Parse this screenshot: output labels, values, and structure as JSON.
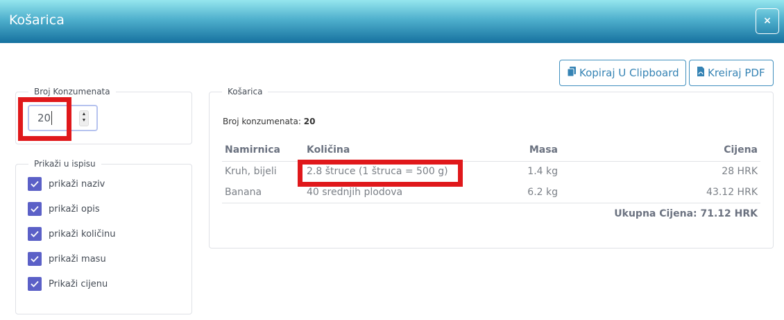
{
  "modal": {
    "title": "Košarica",
    "close_label": "×"
  },
  "toolbar": {
    "copy_label": "Kopiraj U Clipboard",
    "pdf_label": "Kreiraj PDF",
    "copy_icon": "copy-icon",
    "pdf_icon": "pdf-file-icon"
  },
  "consumers": {
    "legend": "Broj Konzumenata",
    "value": "20"
  },
  "print_options": {
    "legend": "Prikaži u ispisu",
    "items": [
      {
        "label": "prikaži naziv",
        "checked": true
      },
      {
        "label": "prikaži opis",
        "checked": true
      },
      {
        "label": "prikaži količinu",
        "checked": true
      },
      {
        "label": "prikaži masu",
        "checked": true
      },
      {
        "label": "Prikaži cijenu",
        "checked": true
      }
    ]
  },
  "cart": {
    "legend": "Košarica",
    "consumer_info_label": "Broj konzumenata:",
    "consumer_info_value": "20",
    "columns": [
      "Namirnica",
      "Količina",
      "Masa",
      "Cijena"
    ],
    "rows": [
      {
        "item": "Kruh, bijeli",
        "quantity": "2.8 štruce (1 štruca = 500 g)",
        "mass": "1.4 kg",
        "price": "28 HRK"
      },
      {
        "item": "Banana",
        "quantity": "40 srednjih plodova",
        "mass": "6.2 kg",
        "price": "43.12 HRK"
      }
    ],
    "total": "Ukupna Cijena: 71.12 HRK"
  },
  "colors": {
    "accent": "#3583b4",
    "checkbox": "#5b60c7",
    "highlight": "#e0181b"
  }
}
